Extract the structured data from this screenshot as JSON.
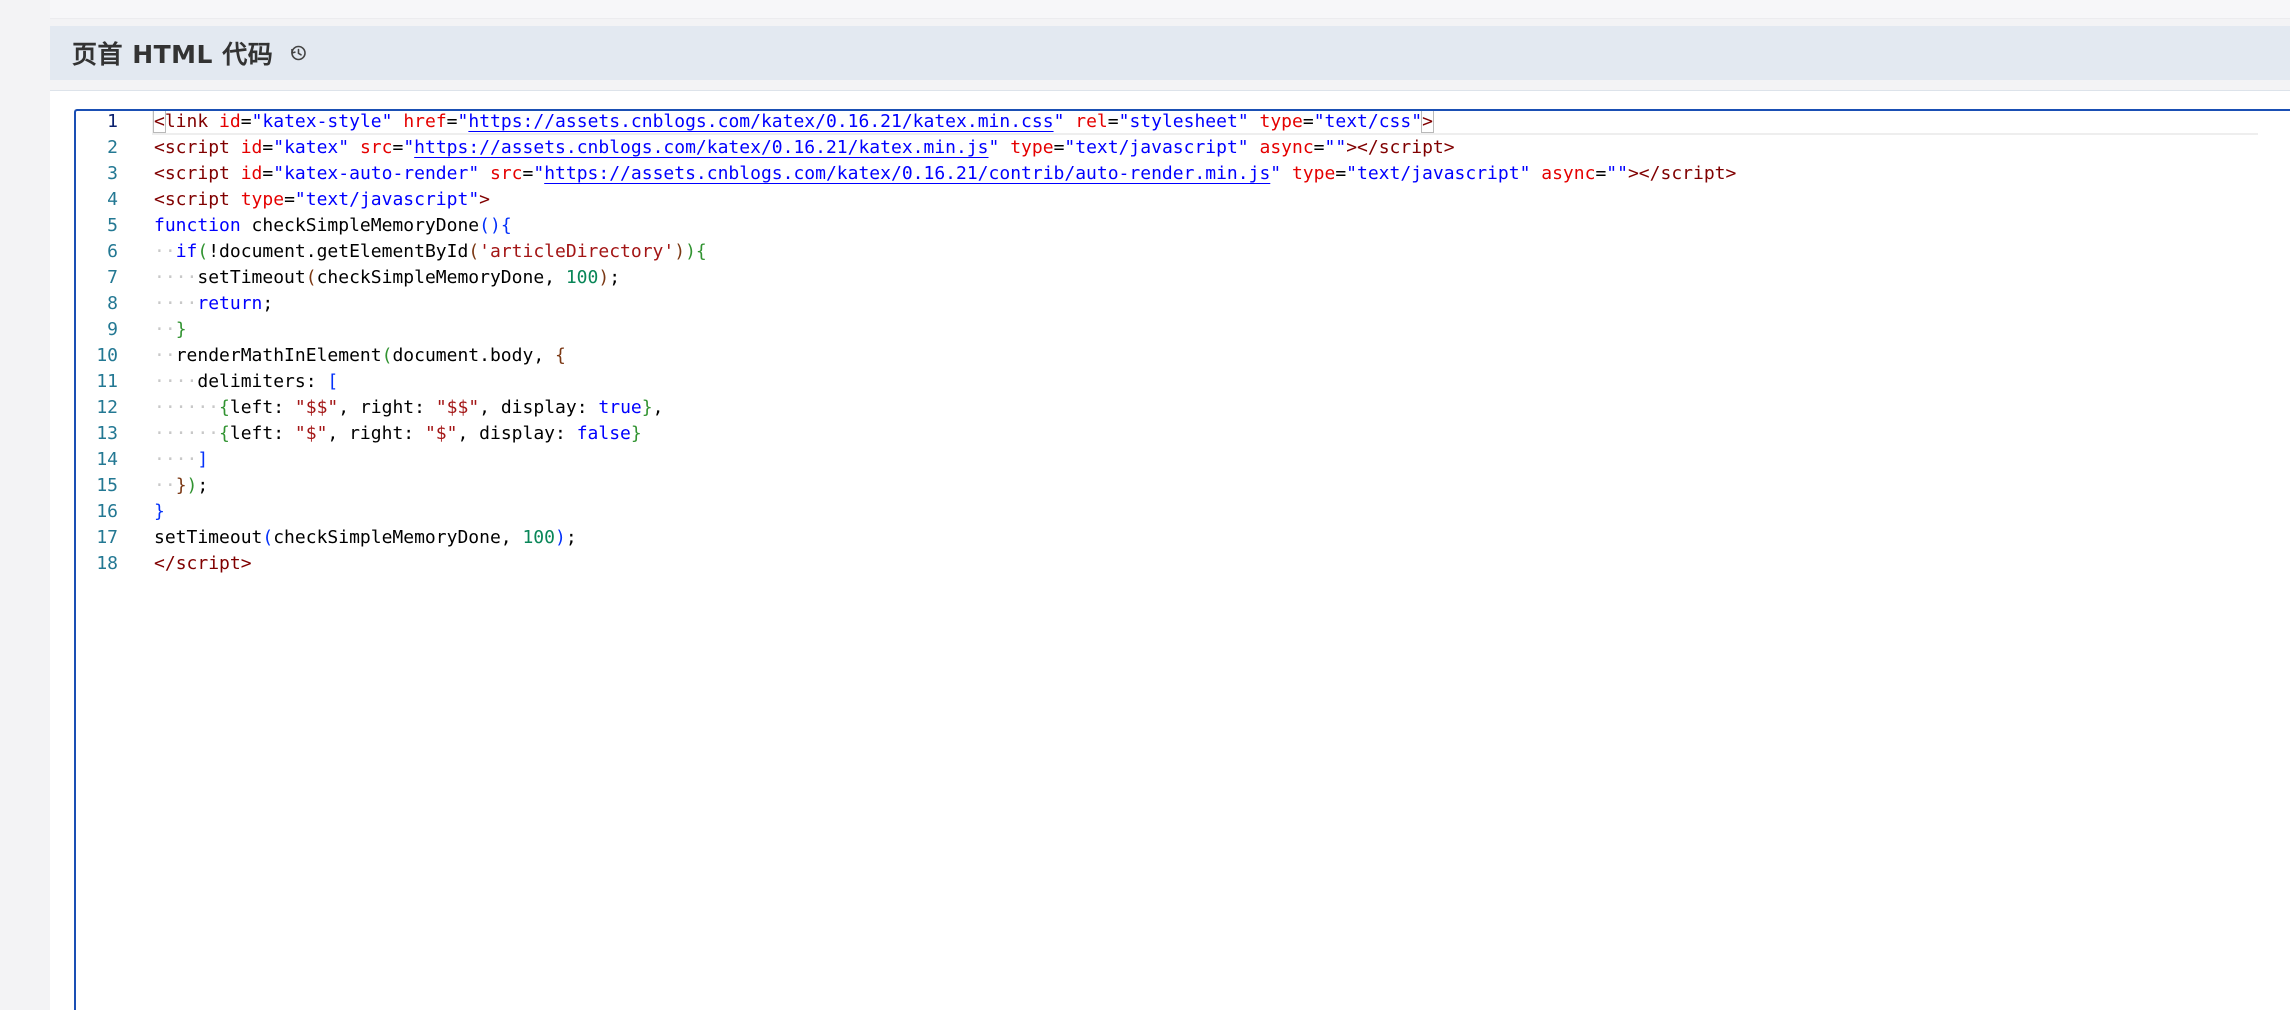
{
  "section": {
    "title": "页首 HTML 代码",
    "history_icon": "history-icon"
  },
  "editor": {
    "current_line": 1,
    "colors": {
      "line_number": "#237893",
      "line_number_current": "#0b216f",
      "focus_border": "#1a4fb4",
      "tag": "#800000",
      "attribute": "#e50000",
      "attr_value": "#0000ff",
      "js_string": "#a31515",
      "keyword": "#0000ff",
      "number": "#098658"
    },
    "lines": [
      {
        "n": "1",
        "tokens": [
          {
            "t": "<",
            "c": "punct match"
          },
          {
            "t": "link",
            "c": "tag"
          },
          {
            "t": " "
          },
          {
            "t": "id",
            "c": "attr"
          },
          {
            "t": "=",
            "c": "eq"
          },
          {
            "t": "\"katex-style\"",
            "c": "str"
          },
          {
            "t": " "
          },
          {
            "t": "href",
            "c": "attr"
          },
          {
            "t": "=",
            "c": "eq"
          },
          {
            "t": "\"",
            "c": "str"
          },
          {
            "t": "https://assets.cnblogs.com/katex/0.16.21/katex.min.css",
            "c": "link"
          },
          {
            "t": "\"",
            "c": "str"
          },
          {
            "t": " "
          },
          {
            "t": "rel",
            "c": "attr"
          },
          {
            "t": "=",
            "c": "eq"
          },
          {
            "t": "\"stylesheet\"",
            "c": "str"
          },
          {
            "t": " "
          },
          {
            "t": "type",
            "c": "attr"
          },
          {
            "t": "=",
            "c": "eq"
          },
          {
            "t": "\"text/css\"",
            "c": "str"
          },
          {
            "t": ">",
            "c": "punct match"
          }
        ]
      },
      {
        "n": "2",
        "tokens": [
          {
            "t": "<",
            "c": "punct"
          },
          {
            "t": "script",
            "c": "tag"
          },
          {
            "t": " "
          },
          {
            "t": "id",
            "c": "attr"
          },
          {
            "t": "=",
            "c": "eq"
          },
          {
            "t": "\"katex\"",
            "c": "str"
          },
          {
            "t": " "
          },
          {
            "t": "src",
            "c": "attr"
          },
          {
            "t": "=",
            "c": "eq"
          },
          {
            "t": "\"",
            "c": "str"
          },
          {
            "t": "https://assets.cnblogs.com/katex/0.16.21/katex.min.js",
            "c": "link"
          },
          {
            "t": "\"",
            "c": "str"
          },
          {
            "t": " "
          },
          {
            "t": "type",
            "c": "attr"
          },
          {
            "t": "=",
            "c": "eq"
          },
          {
            "t": "\"text/javascript\"",
            "c": "str"
          },
          {
            "t": " "
          },
          {
            "t": "async",
            "c": "attr"
          },
          {
            "t": "=",
            "c": "eq"
          },
          {
            "t": "\"\"",
            "c": "str"
          },
          {
            "t": "></",
            "c": "punct"
          },
          {
            "t": "script",
            "c": "tag"
          },
          {
            "t": ">",
            "c": "punct"
          }
        ]
      },
      {
        "n": "3",
        "tokens": [
          {
            "t": "<",
            "c": "punct"
          },
          {
            "t": "script",
            "c": "tag"
          },
          {
            "t": " "
          },
          {
            "t": "id",
            "c": "attr"
          },
          {
            "t": "=",
            "c": "eq"
          },
          {
            "t": "\"katex-auto-render\"",
            "c": "str"
          },
          {
            "t": " "
          },
          {
            "t": "src",
            "c": "attr"
          },
          {
            "t": "=",
            "c": "eq"
          },
          {
            "t": "\"",
            "c": "str"
          },
          {
            "t": "https://assets.cnblogs.com/katex/0.16.21/contrib/auto-render.min.js",
            "c": "link"
          },
          {
            "t": "\"",
            "c": "str"
          },
          {
            "t": " "
          },
          {
            "t": "type",
            "c": "attr"
          },
          {
            "t": "=",
            "c": "eq"
          },
          {
            "t": "\"text/javascript\"",
            "c": "str"
          },
          {
            "t": " "
          },
          {
            "t": "async",
            "c": "attr"
          },
          {
            "t": "=",
            "c": "eq"
          },
          {
            "t": "\"\"",
            "c": "str"
          },
          {
            "t": "></",
            "c": "punct"
          },
          {
            "t": "script",
            "c": "tag"
          },
          {
            "t": ">",
            "c": "punct"
          }
        ]
      },
      {
        "n": "4",
        "tokens": [
          {
            "t": "<",
            "c": "punct"
          },
          {
            "t": "script",
            "c": "tag"
          },
          {
            "t": " "
          },
          {
            "t": "type",
            "c": "attr"
          },
          {
            "t": "=",
            "c": "eq"
          },
          {
            "t": "\"text/javascript\"",
            "c": "str"
          },
          {
            "t": ">",
            "c": "punct"
          }
        ]
      },
      {
        "n": "5",
        "tokens": [
          {
            "t": "function",
            "c": "kw"
          },
          {
            "t": " checkSimpleMemoryDone",
            "c": "plain"
          },
          {
            "t": "()",
            "c": "bracket1"
          },
          {
            "t": "{",
            "c": "bracket1"
          }
        ]
      },
      {
        "n": "6",
        "tokens": [
          {
            "t": "··",
            "c": "ws"
          },
          {
            "t": "if",
            "c": "kw"
          },
          {
            "t": "(",
            "c": "bracket2"
          },
          {
            "t": "!document.getElementById",
            "c": "plain"
          },
          {
            "t": "(",
            "c": "bracket3"
          },
          {
            "t": "'articleDirectory'",
            "c": "jsstr"
          },
          {
            "t": ")",
            "c": "bracket3"
          },
          {
            "t": ")",
            "c": "bracket2"
          },
          {
            "t": "{",
            "c": "bracket2"
          }
        ]
      },
      {
        "n": "7",
        "tokens": [
          {
            "t": "····",
            "c": "ws"
          },
          {
            "t": "setTimeout",
            "c": "plain"
          },
          {
            "t": "(",
            "c": "bracket3"
          },
          {
            "t": "checkSimpleMemoryDone, ",
            "c": "plain"
          },
          {
            "t": "100",
            "c": "num"
          },
          {
            "t": ")",
            "c": "bracket3"
          },
          {
            "t": ";",
            "c": "plain"
          }
        ]
      },
      {
        "n": "8",
        "tokens": [
          {
            "t": "····",
            "c": "ws"
          },
          {
            "t": "return",
            "c": "kw"
          },
          {
            "t": ";",
            "c": "plain"
          }
        ]
      },
      {
        "n": "9",
        "tokens": [
          {
            "t": "··",
            "c": "ws"
          },
          {
            "t": "}",
            "c": "bracket2"
          }
        ]
      },
      {
        "n": "10",
        "tokens": [
          {
            "t": "··",
            "c": "ws"
          },
          {
            "t": "renderMathInElement",
            "c": "plain"
          },
          {
            "t": "(",
            "c": "bracket2"
          },
          {
            "t": "document.body, ",
            "c": "plain"
          },
          {
            "t": "{",
            "c": "bracket3"
          }
        ]
      },
      {
        "n": "11",
        "tokens": [
          {
            "t": "····",
            "c": "ws"
          },
          {
            "t": "delimiters: ",
            "c": "plain"
          },
          {
            "t": "[",
            "c": "bracket1"
          }
        ]
      },
      {
        "n": "12",
        "tokens": [
          {
            "t": "······",
            "c": "ws"
          },
          {
            "t": "{",
            "c": "bracket2"
          },
          {
            "t": "left: ",
            "c": "plain"
          },
          {
            "t": "\"$$\"",
            "c": "jsstr"
          },
          {
            "t": ", right: ",
            "c": "plain"
          },
          {
            "t": "\"$$\"",
            "c": "jsstr"
          },
          {
            "t": ", display: ",
            "c": "plain"
          },
          {
            "t": "true",
            "c": "kw"
          },
          {
            "t": "}",
            "c": "bracket2"
          },
          {
            "t": ",",
            "c": "plain"
          }
        ]
      },
      {
        "n": "13",
        "tokens": [
          {
            "t": "······",
            "c": "ws"
          },
          {
            "t": "{",
            "c": "bracket2"
          },
          {
            "t": "left: ",
            "c": "plain"
          },
          {
            "t": "\"$\"",
            "c": "jsstr"
          },
          {
            "t": ", right: ",
            "c": "plain"
          },
          {
            "t": "\"$\"",
            "c": "jsstr"
          },
          {
            "t": ", display: ",
            "c": "plain"
          },
          {
            "t": "false",
            "c": "kw"
          },
          {
            "t": "}",
            "c": "bracket2"
          }
        ]
      },
      {
        "n": "14",
        "tokens": [
          {
            "t": "····",
            "c": "ws"
          },
          {
            "t": "]",
            "c": "bracket1"
          }
        ]
      },
      {
        "n": "15",
        "tokens": [
          {
            "t": "··",
            "c": "ws"
          },
          {
            "t": "}",
            "c": "bracket3"
          },
          {
            "t": ")",
            "c": "bracket2"
          },
          {
            "t": ";",
            "c": "plain"
          }
        ]
      },
      {
        "n": "16",
        "tokens": [
          {
            "t": "}",
            "c": "bracket1"
          }
        ]
      },
      {
        "n": "17",
        "tokens": [
          {
            "t": "setTimeout",
            "c": "plain"
          },
          {
            "t": "(",
            "c": "bracket1"
          },
          {
            "t": "checkSimpleMemoryDone, ",
            "c": "plain"
          },
          {
            "t": "100",
            "c": "num"
          },
          {
            "t": ")",
            "c": "bracket1"
          },
          {
            "t": ";",
            "c": "plain"
          }
        ]
      },
      {
        "n": "18",
        "tokens": [
          {
            "t": "</",
            "c": "punct"
          },
          {
            "t": "script",
            "c": "tag"
          },
          {
            "t": ">",
            "c": "punct"
          }
        ]
      }
    ]
  }
}
